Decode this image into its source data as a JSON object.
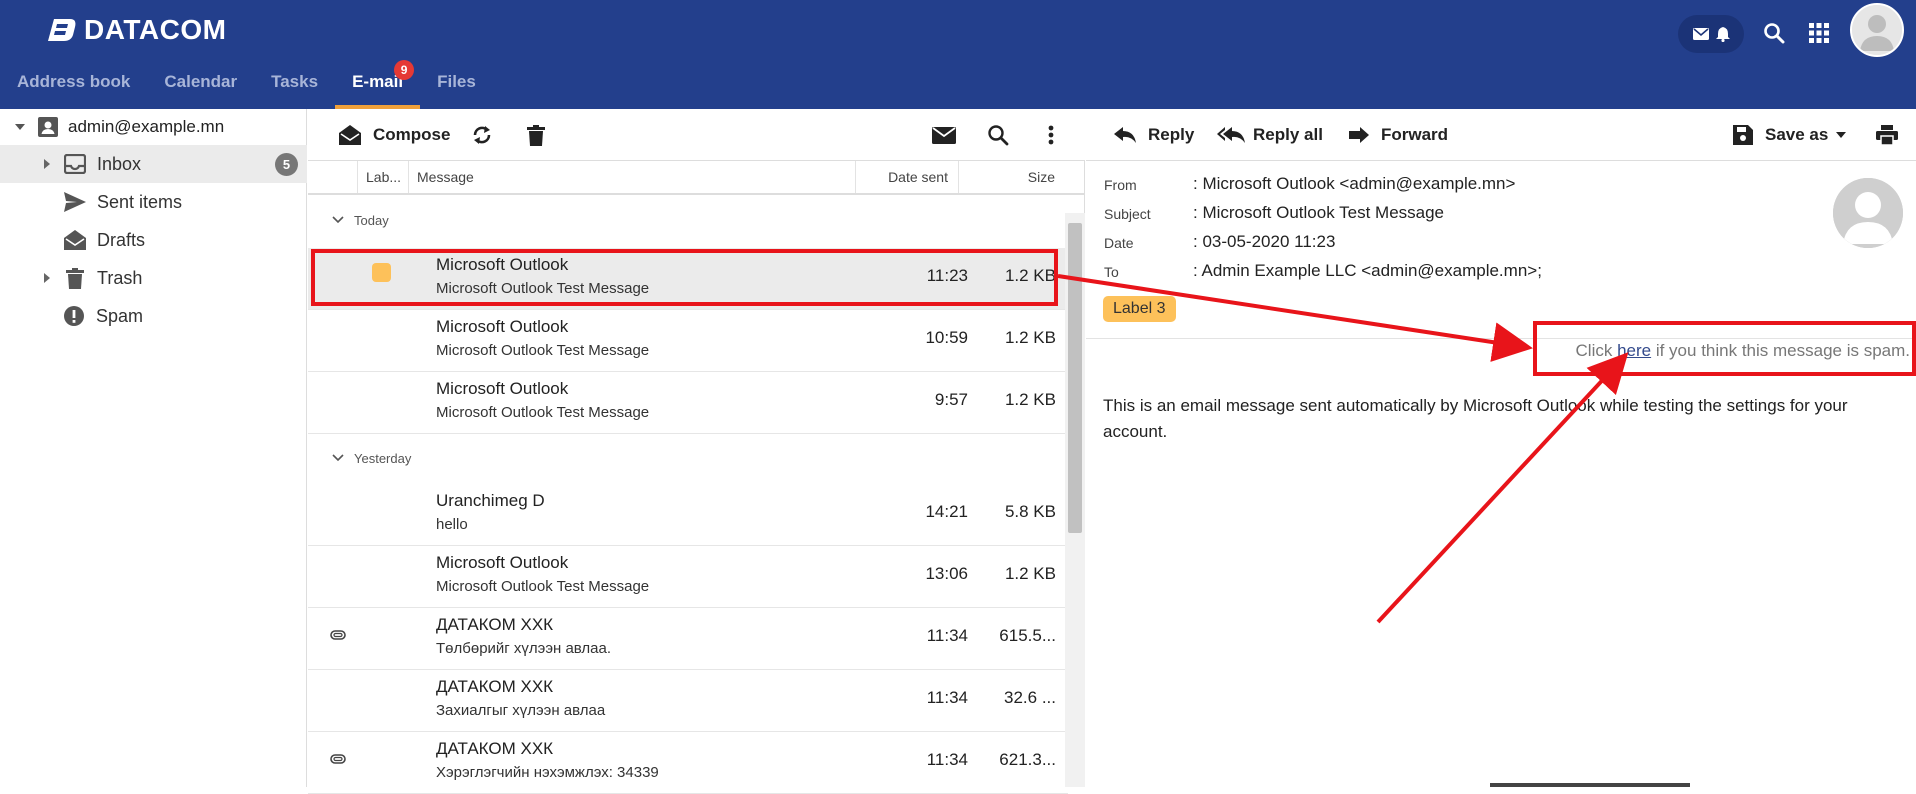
{
  "brand": {
    "name": "DATACOM"
  },
  "nav": {
    "tabs": [
      {
        "label": "Address book"
      },
      {
        "label": "Calendar"
      },
      {
        "label": "Tasks"
      },
      {
        "label": "E-mail",
        "badge": "9",
        "active": true
      },
      {
        "label": "Files"
      }
    ]
  },
  "topbar_icons": [
    "mail-icon",
    "bell-icon",
    "search-icon",
    "apps-grid-icon",
    "user-avatar"
  ],
  "folders": {
    "account": "admin@example.mn",
    "items": [
      {
        "label": "Inbox",
        "count": "5",
        "active": true
      },
      {
        "label": "Sent items"
      },
      {
        "label": "Drafts"
      },
      {
        "label": "Trash"
      },
      {
        "label": "Spam"
      }
    ]
  },
  "list_toolbar": {
    "compose_label": "Compose"
  },
  "list_columns": {
    "label": "Lab...",
    "message": "Message",
    "date": "Date sent",
    "size": "Size"
  },
  "groups": {
    "today": "Today",
    "yesterday": "Yesterday"
  },
  "messages": [
    {
      "sender": "Microsoft Outlook",
      "subject": "Microsoft Outlook Test Message",
      "time": "11:23",
      "size": "1.2 KB"
    },
    {
      "sender": "Microsoft Outlook",
      "subject": "Microsoft Outlook Test Message",
      "time": "10:59",
      "size": "1.2 KB"
    },
    {
      "sender": "Microsoft Outlook",
      "subject": "Microsoft Outlook Test Message",
      "time": "9:57",
      "size": "1.2 KB"
    },
    {
      "sender": "Uranchimeg D",
      "subject": "hello",
      "time": "14:21",
      "size": "5.8 KB"
    },
    {
      "sender": "Microsoft Outlook",
      "subject": "Microsoft Outlook Test Message",
      "time": "13:06",
      "size": "1.2 KB"
    },
    {
      "sender": "ДАТАКОМ ХХК",
      "subject": "Төлбөрийг хүлээн авлаа.",
      "time": "11:34",
      "size": "615.5..."
    },
    {
      "sender": "ДАТАКОМ ХХК",
      "subject": "Захиалгыг хүлээн авлаа",
      "time": "11:34",
      "size": "32.6 ..."
    },
    {
      "sender": "ДАТАКОМ ХХК",
      "subject": "Хэрэглэгчийн нэхэмжлэх: 34339",
      "time": "11:34",
      "size": "621.3..."
    }
  ],
  "reader": {
    "toolbar": {
      "reply": "Reply",
      "reply_all": "Reply all",
      "forward": "Forward",
      "save_as": "Save as"
    },
    "meta": {
      "from_label": "From",
      "from_value": ": Microsoft Outlook <admin@example.mn>",
      "subject_label": "Subject",
      "subject_value": ": Microsoft Outlook Test Message",
      "date_label": "Date",
      "date_value": ": 03-05-2020 11:23",
      "to_label": "To",
      "to_value": ": Admin Example LLC <admin@example.mn>;"
    },
    "label_chip": "Label 3",
    "spam": {
      "before": "Click ",
      "link": "here",
      "after": " if you think this message is spam."
    },
    "body": "This is an email message sent automatically by Microsoft Outlook while testing the settings for your account."
  },
  "colors": {
    "header": "#233f8c",
    "active_tab_underline": "#f0a03a",
    "badge": "#e53935",
    "label_yellow": "#fdc15a",
    "annotation_red": "#e8141a"
  }
}
